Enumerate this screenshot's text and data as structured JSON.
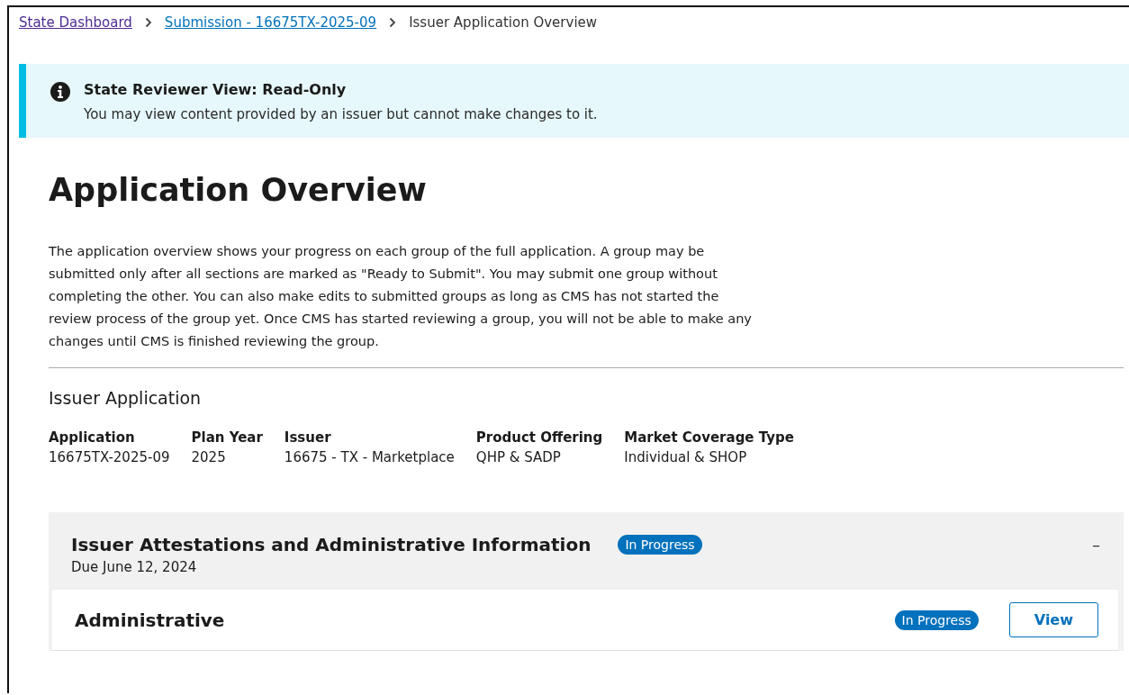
{
  "breadcrumb": [
    {
      "label": "State Dashboard",
      "kind": "visited_link"
    },
    {
      "label": "Submission - 16675TX-2025-09",
      "kind": "link"
    },
    {
      "label": "Issuer Application Overview",
      "kind": "current"
    }
  ],
  "alert": {
    "title": "State Reviewer View: Read-Only",
    "text": "You may view content provided by an issuer but cannot make changes to it."
  },
  "heading": "Application Overview",
  "intro": "The application overview shows your progress on each group of the full application. A group may be submitted only after all sections are marked as \"Ready to Submit\". You may submit one group without completing the other. You can also make edits to submitted groups as long as CMS has not started the review process of the group yet. Once CMS has started reviewing a group, you will not be able to make any changes until CMS is finished reviewing the group.",
  "application": {
    "title": "Issuer Application",
    "fields": [
      {
        "label": "Application",
        "value": "16675TX-2025-09"
      },
      {
        "label": "Plan Year",
        "value": "2025"
      },
      {
        "label": "Issuer",
        "value": "16675 - TX - Marketplace"
      },
      {
        "label": "Product Offering",
        "value": "QHP & SADP"
      },
      {
        "label": "Market Coverage Type",
        "value": "Individual & SHOP"
      }
    ]
  },
  "group": {
    "title": "Issuer Attestations and Administrative Information",
    "due": "Due June 12, 2024",
    "status": "In Progress",
    "toggle": "–",
    "sections": [
      {
        "title": "Administrative",
        "status": "In Progress",
        "action": "View"
      }
    ]
  }
}
